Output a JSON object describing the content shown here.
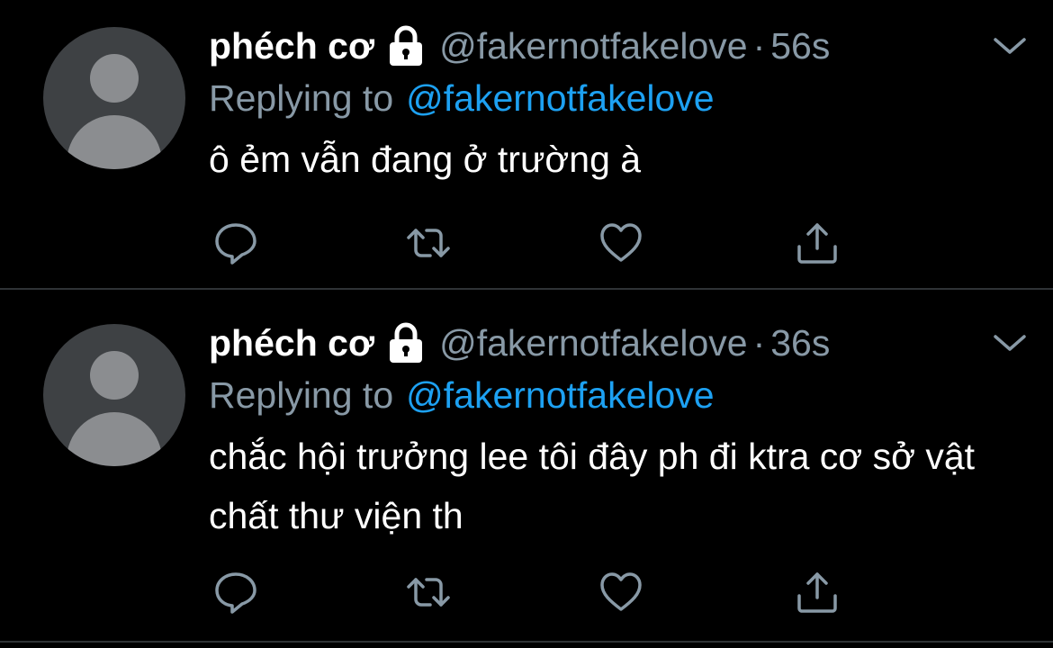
{
  "colors": {
    "background": "#000000",
    "text_primary": "#ffffff",
    "text_secondary": "#8899a6",
    "link": "#1da1f2",
    "divider": "#2f3336",
    "avatar_bg": "#3e4144",
    "avatar_fg": "#8b8d90"
  },
  "tweets": [
    {
      "display_name": "phéch cơ",
      "protected_icon": "lock-icon",
      "handle": "@fakernotfakelove",
      "separator": "·",
      "time": "56s",
      "replying_prefix": "Replying to",
      "replying_to": "@fakernotfakelove",
      "text": "ô ẻm vẫn đang ở trường à",
      "menu_icon": "chevron-down-icon",
      "actions": [
        "reply-icon",
        "retweet-icon",
        "like-icon",
        "share-icon"
      ]
    },
    {
      "display_name": "phéch cơ",
      "protected_icon": "lock-icon",
      "handle": "@fakernotfakelove",
      "separator": "·",
      "time": "36s",
      "replying_prefix": "Replying to",
      "replying_to": "@fakernotfakelove",
      "text": "chắc hội trưởng lee tôi đây ph đi ktra cơ sở vật chất thư viện th",
      "menu_icon": "chevron-down-icon",
      "actions": [
        "reply-icon",
        "retweet-icon",
        "like-icon",
        "share-icon"
      ]
    }
  ]
}
